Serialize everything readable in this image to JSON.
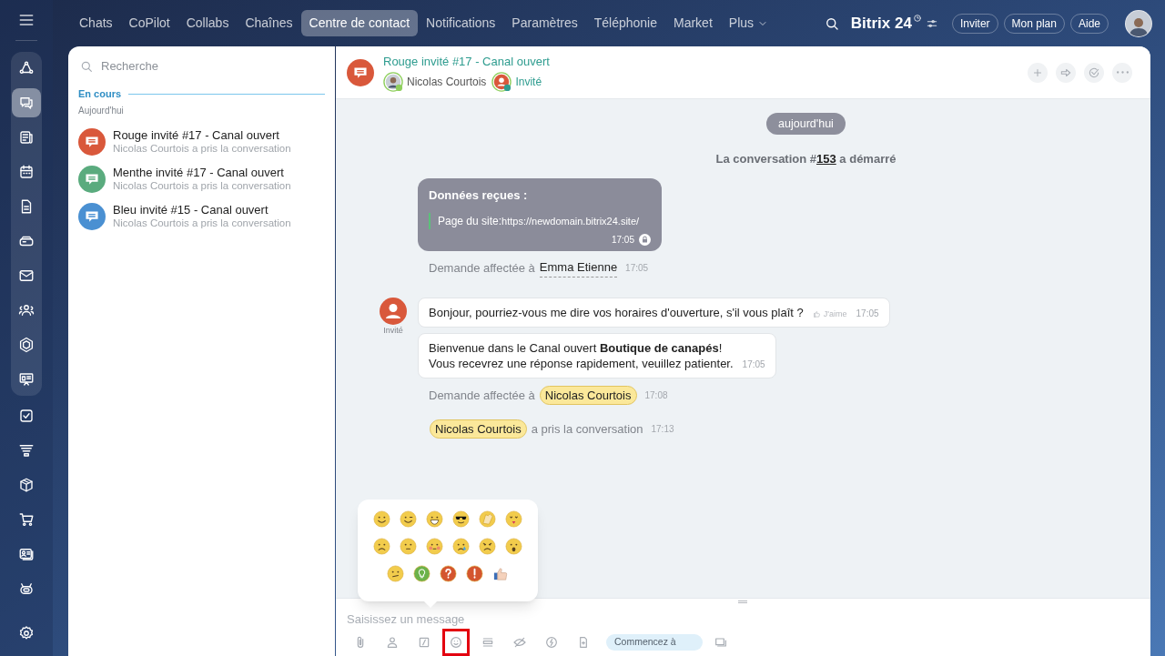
{
  "top_nav": {
    "tabs": [
      {
        "label": "Chats",
        "selected": false
      },
      {
        "label": "CoPilot",
        "selected": false
      },
      {
        "label": "Collabs",
        "selected": false
      },
      {
        "label": "Chaînes",
        "selected": false
      },
      {
        "label": "Centre de contact",
        "selected": true
      },
      {
        "label": "Notifications",
        "selected": false
      },
      {
        "label": "Paramètres",
        "selected": false
      },
      {
        "label": "Téléphonie",
        "selected": false
      },
      {
        "label": "Market",
        "selected": false
      }
    ],
    "more": "Plus",
    "logo": "Bitrix 24",
    "buttons": [
      "Inviter",
      "Mon plan",
      "Aide"
    ]
  },
  "sidebar": {
    "pinned": [
      {
        "selected": false
      },
      {
        "selected": true
      },
      {
        "selected": false
      },
      {
        "selected": false
      },
      {
        "selected": false
      },
      {
        "selected": false
      },
      {
        "selected": false
      },
      {
        "selected": false
      },
      {
        "selected": false
      },
      {
        "selected": false
      }
    ],
    "items": [
      {
        "selected": false
      },
      {
        "selected": false
      },
      {
        "selected": false
      },
      {
        "selected": false
      },
      {
        "selected": false
      },
      {
        "selected": false
      }
    ]
  },
  "chat_list": {
    "search_placeholder": "Recherche",
    "section": "En cours",
    "date": "Aujourd'hui",
    "items": [
      {
        "title": "Rouge invité #17 - Canal ouvert",
        "subtitle": "Nicolas Courtois a pris la conversation",
        "color": "#d9583b"
      },
      {
        "title": "Menthe invité #17 - Canal ouvert",
        "subtitle": "Nicolas Courtois a pris la conversation",
        "color": "#5aab7e"
      },
      {
        "title": "Bleu invité #15 - Canal ouvert",
        "subtitle": "Nicolas Courtois a pris la conversation",
        "color": "#4a90d2"
      }
    ]
  },
  "chat": {
    "title": "Rouge invité #17 - Canal ouvert",
    "color": "#d9583b",
    "participants": [
      {
        "name": "Nicolas Courtois",
        "kind": "operator"
      },
      {
        "name": "Invité",
        "kind": "guest"
      }
    ],
    "date_pill": "aujourd'hui",
    "started": {
      "before": "La conversation #",
      "number": "153",
      "after": " a démarré"
    },
    "messages": [
      {
        "kind": "form",
        "title": "Données reçues :",
        "label": "Page du site:",
        "url": "https://newdomain.bitrix24.site/",
        "time": "17:05"
      },
      {
        "kind": "system",
        "text": "Demande affectée à",
        "name": "Emma Etienne",
        "name_first": false,
        "highlighted": false,
        "time": "17:05"
      },
      {
        "kind": "bubble",
        "author": "Invité",
        "text": "Bonjour, pourriez-vous me dire vos horaires d'ouverture, s'il vous plaît ?",
        "like": "J'aime",
        "time": "17:05"
      },
      {
        "kind": "bubble",
        "text": "Bienvenue dans le Canal ouvert **Boutique de canapés**!\nVous recevrez une réponse rapidement, veuillez patienter.",
        "time": "17:05"
      },
      {
        "kind": "system",
        "text": "Demande affectée à",
        "name": "Nicolas Courtois",
        "name_first": false,
        "highlighted": true,
        "time": "17:08"
      },
      {
        "kind": "system",
        "text": "a pris la conversation",
        "name": "Nicolas Courtois",
        "name_first": true,
        "highlighted": true,
        "time": "17:13"
      }
    ],
    "composer": {
      "placeholder": "Saisissez un message",
      "start_button": "Commencez à",
      "emoji_highlighted": true,
      "emoji_open": true
    }
  }
}
